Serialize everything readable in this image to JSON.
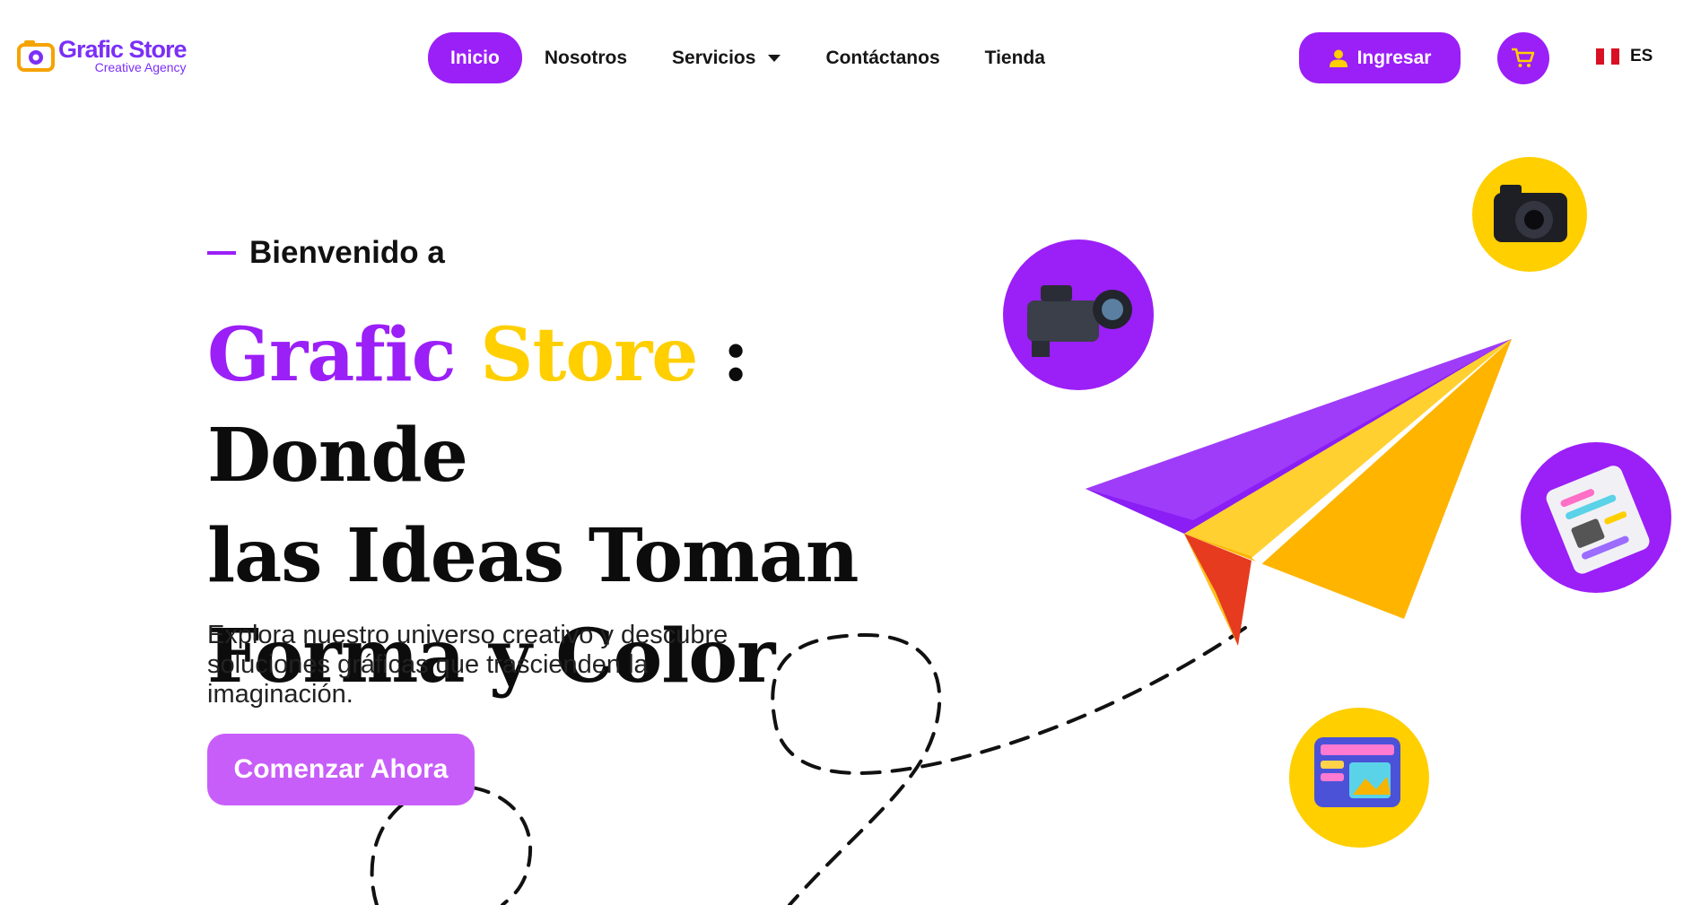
{
  "header": {
    "logo_title": "Grafic Store",
    "logo_subtitle": "Creative Agency",
    "nav": [
      {
        "label": "Inicio",
        "active": true
      },
      {
        "label": "Nosotros",
        "active": false
      },
      {
        "label": "Servicios",
        "active": false,
        "dropdown": true
      },
      {
        "label": "Contáctanos",
        "active": false
      },
      {
        "label": "Tienda",
        "active": false
      }
    ],
    "login_label": "Ingresar",
    "cart_icon": "cart-icon",
    "language": "ES"
  },
  "hero": {
    "kicker": "Bienvenido a",
    "title_brand1": "Grafic",
    "title_brand2": "Store",
    "title_rest_1": " : Donde",
    "title_line2": "las Ideas Toman",
    "title_line3": "Forma y Color",
    "description": "Explora nuestro universo creativo y descubre soluciones gráficas que trascienden la imaginación.",
    "cta_label": "Comenzar Ahora"
  },
  "colors": {
    "primary": "#9b1ff7",
    "accent": "#ffcf00",
    "cta": "#c85ef9",
    "text": "#111111"
  },
  "illustration": {
    "icons": [
      "video-camera-icon",
      "photo-camera-icon",
      "document-icon",
      "web-design-icon",
      "paper-plane-icon"
    ]
  }
}
